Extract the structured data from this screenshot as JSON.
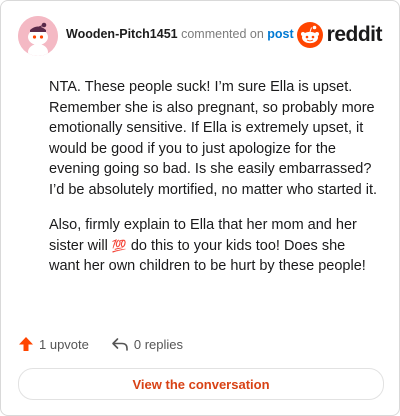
{
  "header": {
    "username": "Wooden-Pitch1451",
    "commented_on": "commented on",
    "post_link": "post",
    "logo_text": "reddit"
  },
  "comment": {
    "paragraph1": "NTA. These people suck! I’m sure Ella is upset. Remember she is also pregnant, so probably more emotionally sensitive. If Ella is extremely upset, it would be good if you to just apologize for the evening going so bad. Is she easily embarrassed? I’d be absolutely mortified, no matter who started it.",
    "paragraph2_before": "Also, firmly explain to Ella that her mom and her sister will ",
    "emoji": "💯",
    "paragraph2_after": " do this to your kids too! Does she want her own children to be hurt by these people!"
  },
  "footer": {
    "upvotes": "1 upvote",
    "replies": "0 replies"
  },
  "cta": {
    "label": "View the conversation"
  },
  "colors": {
    "upvote": "#ff4500",
    "link": "#0079d3",
    "cta_text": "#d84215",
    "avatar_bg": "#f4b9c4"
  },
  "icons": [
    "snoo-avatar",
    "reddit-logo-icon",
    "upvote-arrow-icon",
    "reply-arrow-icon"
  ]
}
